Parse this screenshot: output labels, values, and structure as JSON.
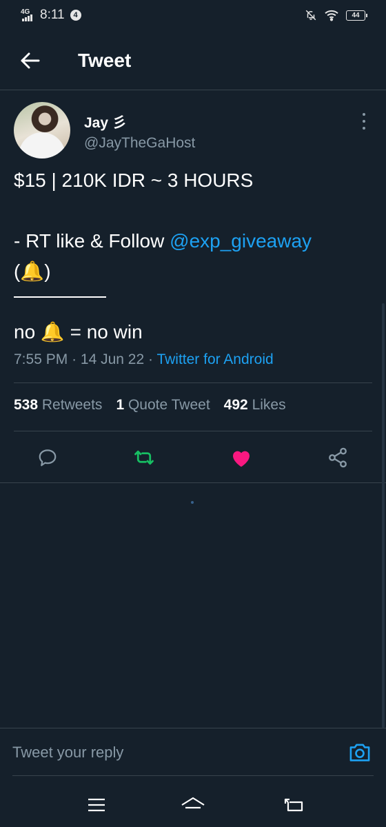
{
  "status_bar": {
    "network": "4G",
    "time": "8:11",
    "notification_count": "4",
    "battery": "44"
  },
  "header": {
    "title": "Tweet"
  },
  "tweet": {
    "author_name": "Jay 彡",
    "author_handle": "@JayTheGaHost",
    "line1": "$15 | 210K IDR ~ 3 HOURS",
    "line2_prefix": "- RT like & Follow ",
    "mention": "@exp_giveaway",
    "line3": "(🔔)",
    "line4": "no 🔔 = no win",
    "time": "7:55 PM",
    "date": "14 Jun 22",
    "source": "Twitter for Android"
  },
  "stats": {
    "retweets_count": "538",
    "retweets_label": "Retweets",
    "quotes_count": "1",
    "quotes_label": "Quote Tweet",
    "likes_count": "492",
    "likes_label": "Likes"
  },
  "colors": {
    "background": "#15202b",
    "accent": "#1da1f2",
    "retweet_active": "#17bf63",
    "like_active": "#f91880",
    "muted": "#8899a6"
  },
  "icons": {
    "back": "arrow-left-icon",
    "more": "vertical-dots-icon",
    "reply": "speech-bubble-icon",
    "retweet": "retweet-icon",
    "like": "heart-icon",
    "share": "share-icon",
    "camera": "camera-icon"
  },
  "reply": {
    "placeholder": "Tweet your reply"
  }
}
